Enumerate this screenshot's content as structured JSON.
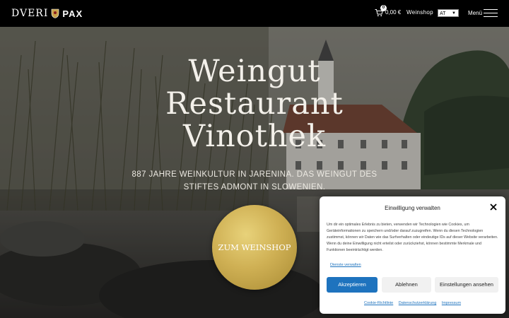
{
  "header": {
    "logo_text_1": "DVERI",
    "logo_text_2": "PAX",
    "cart_count": "0",
    "cart_total": "0,00 €",
    "weinshop_link": "Weinshop",
    "country_value": "AT",
    "menu_label": "Menü"
  },
  "hero": {
    "title_lines": [
      "Weingut",
      "Restaurant",
      "Vinothek"
    ],
    "subtitle": "887 JAHRE WEINKULTUR IN JARENINA. DAS WEINGUT DES STIFTES ADMONT IN SLOWENIEN.",
    "cta_label": "ZUM WEINSHOP"
  },
  "consent": {
    "title": "Einwilligung verwalten",
    "body": "Um dir ein optimales Erlebnis zu bieten, verwenden wir Technologien wie Cookies, um Geräteinformationen zu speichern und/oder darauf zuzugreifen. Wenn du diesen Technologien zustimmst, können wir Daten wie das Surfverhalten oder eindeutige IDs auf dieser Website verarbeiten. Wenn du deine Einwilligung nicht erteilst oder zurückziehst, können bestimmte Merkmale und Funktionen beeinträchtigt werden.",
    "manage_link": "Dienste verwalten",
    "accept_label": "Akzeptieren",
    "deny_label": "Ablehnen",
    "settings_label": "Einstellungen ansehen",
    "footer_links": [
      "Cookie-Richtlinie",
      "Datenschutzerklärung",
      "Impressum"
    ]
  },
  "colors": {
    "accent": "#1e73be",
    "gold": "#cfb054",
    "header_bg": "#000000"
  }
}
